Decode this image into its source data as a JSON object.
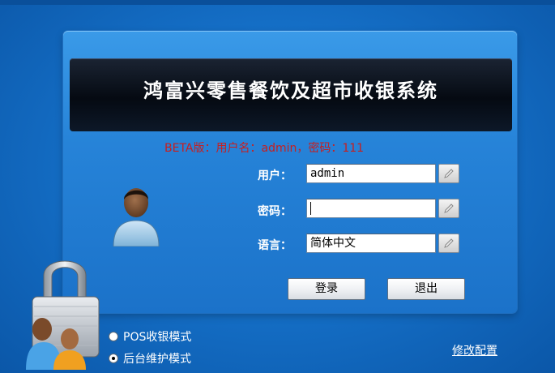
{
  "banner": {
    "title": "鸿富兴零售餐饮及超市收银系统"
  },
  "beta_hint": "BETA版：用户名：admin，密码：111",
  "form": {
    "user_label": "用户：",
    "user_value": "admin",
    "password_label": "密码：",
    "password_value": "",
    "language_label": "语言：",
    "language_value": "简体中文"
  },
  "buttons": {
    "login": "登录",
    "exit": "退出"
  },
  "modes": {
    "pos": "POS收银模式",
    "backend": "后台维护模式",
    "selected": "backend"
  },
  "config_link": "修改配置",
  "colors": {
    "background": "#1570c8",
    "banner": "#050a12",
    "hint": "#c81e1e"
  }
}
